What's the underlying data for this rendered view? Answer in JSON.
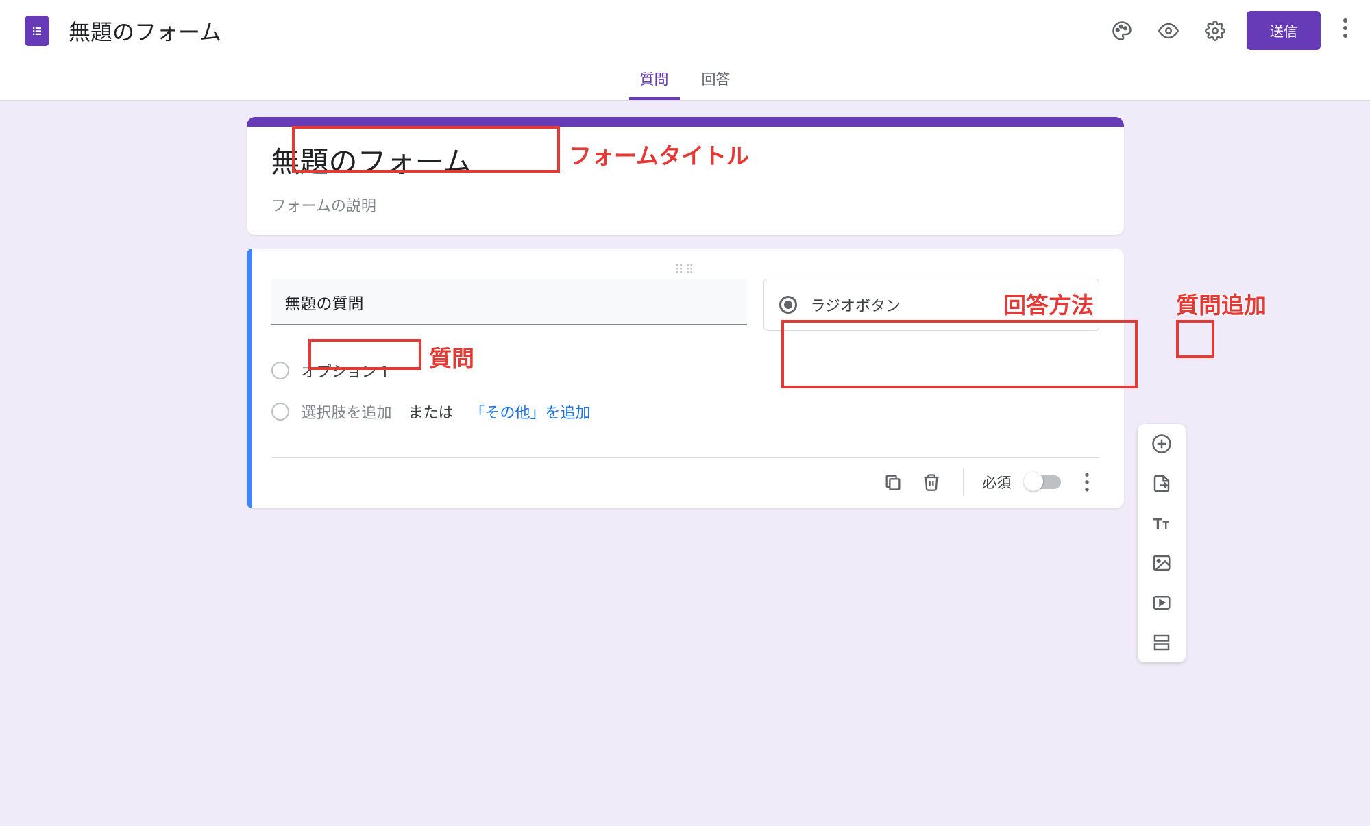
{
  "header": {
    "doc_title": "無題のフォーム",
    "send_button": "送信"
  },
  "tabs": {
    "questions": "質問",
    "responses": "回答"
  },
  "form_header": {
    "title": "無題のフォーム",
    "description_placeholder": "フォームの説明"
  },
  "question": {
    "text": "無題の質問",
    "type_label": "ラジオボタン",
    "option1": "オプション 1",
    "add_option_placeholder": "選択肢を追加",
    "or_text": "または",
    "add_other": "「その他」を追加",
    "required_label": "必須"
  },
  "annotations": {
    "form_title": "フォームタイトル",
    "question": "質問",
    "answer_method": "回答方法",
    "add_question": "質問追加"
  },
  "icon_names": {
    "palette": "palette-icon",
    "preview": "preview-icon",
    "settings": "settings-icon",
    "more": "more-icon",
    "copy": "copy-icon",
    "delete": "delete-icon",
    "add": "add-icon",
    "import": "import-icon",
    "text": "text-icon",
    "image": "image-icon",
    "video": "video-icon",
    "section": "section-icon"
  }
}
